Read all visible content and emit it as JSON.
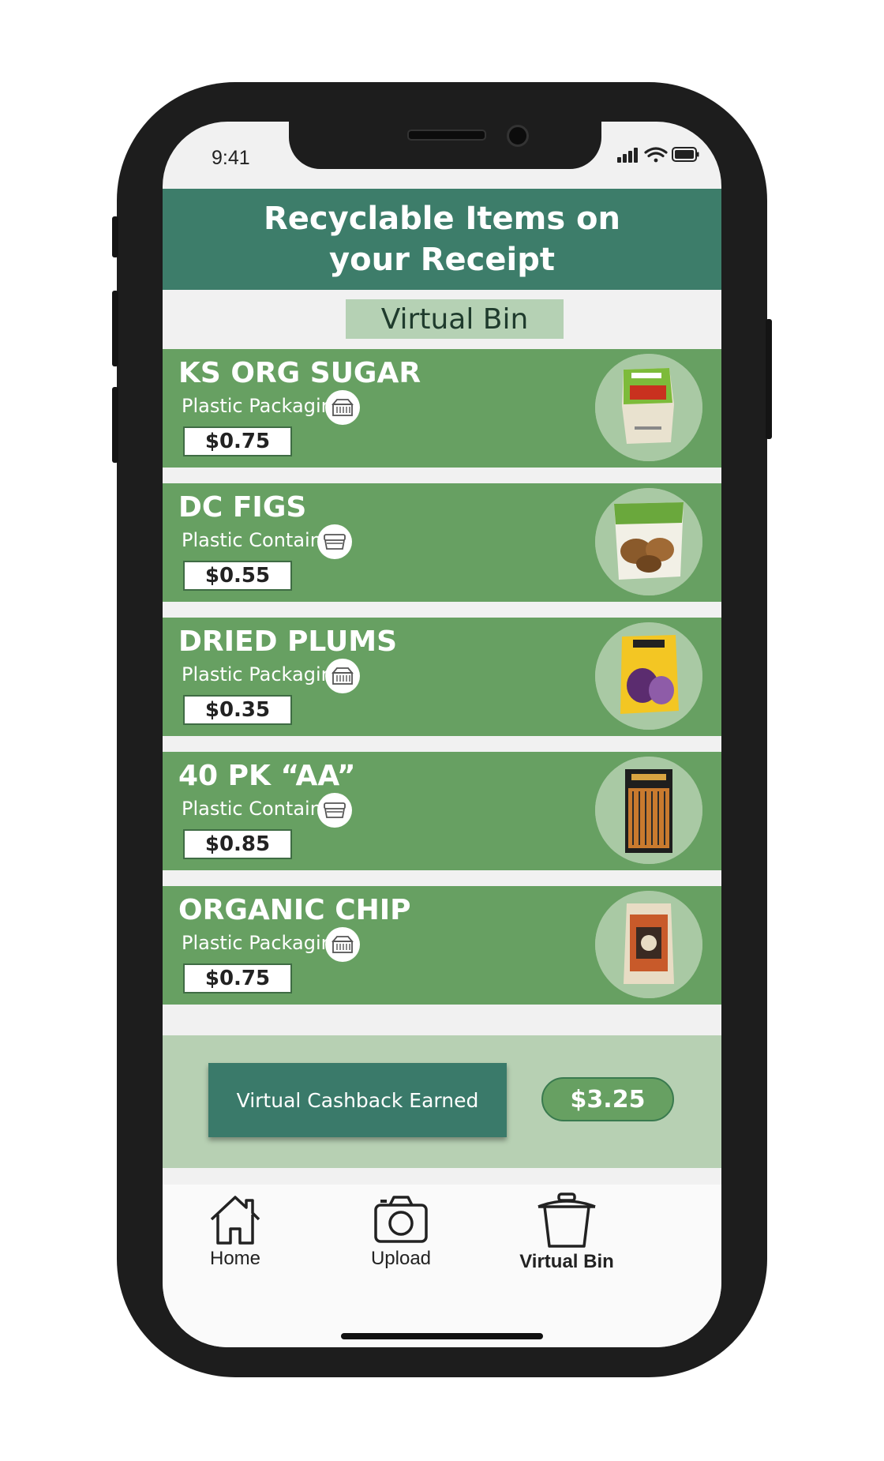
{
  "status_bar": {
    "time": "9:41"
  },
  "header": {
    "title": "Recyclable Items on your Receipt"
  },
  "tab": {
    "label": "Virtual Bin"
  },
  "items": [
    {
      "name": "KS ORG SUGAR",
      "type": "Plastic Packaging",
      "type_icon": "packaging-icon",
      "price": "$0.75"
    },
    {
      "name": "DC FIGS",
      "type": "Plastic Container",
      "type_icon": "container-icon",
      "price": "$0.55"
    },
    {
      "name": "DRIED PLUMS",
      "type": "Plastic Packaging",
      "type_icon": "packaging-icon",
      "price": "$0.35"
    },
    {
      "name": "40 PK “AA”",
      "type": "Plastic Container",
      "type_icon": "container-icon",
      "price": "$0.85"
    },
    {
      "name": "ORGANIC CHIP",
      "type": "Plastic Packaging",
      "type_icon": "packaging-icon",
      "price": "$0.75"
    }
  ],
  "cashback": {
    "label": "Virtual Cashback Earned",
    "amount": "$3.25"
  },
  "nav": [
    {
      "label": "Home",
      "icon": "home-icon"
    },
    {
      "label": "Upload",
      "icon": "camera-icon"
    },
    {
      "label": "Virtual Bin",
      "icon": "trash-bin-icon",
      "active": true
    }
  ],
  "colors": {
    "header_bg": "#3d7d6a",
    "item_bg": "#67a062",
    "tab_bg": "#b5d1b4",
    "cashback_bg": "#b7d0b3",
    "cash_label_bg": "#3a7a6a"
  }
}
